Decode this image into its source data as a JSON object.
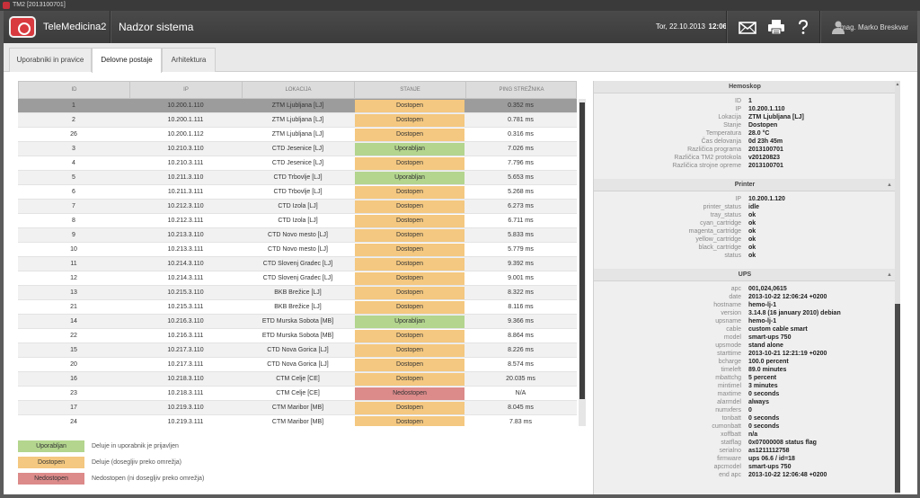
{
  "window": {
    "title": "TM2  [2013100701]"
  },
  "header": {
    "brand": "TeleMedicina2",
    "title": "Nadzor sistema",
    "date": "Tor, 22.10.2013",
    "time": "12:06",
    "user": "mag. Marko Breskvar",
    "icons": [
      "envelope-icon",
      "printer-icon",
      "help-icon",
      "user-icon"
    ]
  },
  "tabs": [
    {
      "label": "Uporabniki in pravice",
      "active": false
    },
    {
      "label": "Delovne postaje",
      "active": true
    },
    {
      "label": "Arhitektura",
      "active": false
    }
  ],
  "table": {
    "headers": [
      "ID",
      "IP",
      "LOKACIJA",
      "STANJE",
      "PING STREŽNIKA"
    ],
    "rows": [
      {
        "id": "1",
        "ip": "10.200.1.110",
        "loc": "ZTM Ljubljana [LJ]",
        "state": "Dostopen",
        "ping": "0.352 ms",
        "selected": true
      },
      {
        "id": "2",
        "ip": "10.200.1.111",
        "loc": "ZTM Ljubljana [LJ]",
        "state": "Dostopen",
        "ping": "0.781 ms"
      },
      {
        "id": "26",
        "ip": "10.200.1.112",
        "loc": "ZTM Ljubljana [LJ]",
        "state": "Dostopen",
        "ping": "0.316 ms"
      },
      {
        "id": "3",
        "ip": "10.210.3.110",
        "loc": "CTD Jesenice [LJ]",
        "state": "Uporabljan",
        "ping": "7.026 ms"
      },
      {
        "id": "4",
        "ip": "10.210.3.111",
        "loc": "CTD Jesenice [LJ]",
        "state": "Dostopen",
        "ping": "7.796 ms"
      },
      {
        "id": "5",
        "ip": "10.211.3.110",
        "loc": "CTD Trbovlje [LJ]",
        "state": "Uporabljan",
        "ping": "5.653 ms"
      },
      {
        "id": "6",
        "ip": "10.211.3.111",
        "loc": "CTD Trbovlje [LJ]",
        "state": "Dostopen",
        "ping": "5.268 ms"
      },
      {
        "id": "7",
        "ip": "10.212.3.110",
        "loc": "CTD Izola [LJ]",
        "state": "Dostopen",
        "ping": "6.273 ms"
      },
      {
        "id": "8",
        "ip": "10.212.3.111",
        "loc": "CTD Izola [LJ]",
        "state": "Dostopen",
        "ping": "6.711 ms"
      },
      {
        "id": "9",
        "ip": "10.213.3.110",
        "loc": "CTD Novo mesto [LJ]",
        "state": "Dostopen",
        "ping": "5.833 ms"
      },
      {
        "id": "10",
        "ip": "10.213.3.111",
        "loc": "CTD Novo mesto [LJ]",
        "state": "Dostopen",
        "ping": "5.779 ms"
      },
      {
        "id": "11",
        "ip": "10.214.3.110",
        "loc": "CTD Slovenj Gradec [LJ]",
        "state": "Dostopen",
        "ping": "9.392 ms"
      },
      {
        "id": "12",
        "ip": "10.214.3.111",
        "loc": "CTD Slovenj Gradec [LJ]",
        "state": "Dostopen",
        "ping": "9.001 ms"
      },
      {
        "id": "13",
        "ip": "10.215.3.110",
        "loc": "BKB Brežice [LJ]",
        "state": "Dostopen",
        "ping": "8.322 ms"
      },
      {
        "id": "21",
        "ip": "10.215.3.111",
        "loc": "BKB Brežice [LJ]",
        "state": "Dostopen",
        "ping": "8.116 ms"
      },
      {
        "id": "14",
        "ip": "10.216.3.110",
        "loc": "ETD Murska Sobota [MB]",
        "state": "Uporabljan",
        "ping": "9.366 ms"
      },
      {
        "id": "22",
        "ip": "10.216.3.111",
        "loc": "ETD Murska Sobota [MB]",
        "state": "Dostopen",
        "ping": "8.864 ms"
      },
      {
        "id": "15",
        "ip": "10.217.3.110",
        "loc": "CTD Nova Gorica [LJ]",
        "state": "Dostopen",
        "ping": "8.226 ms"
      },
      {
        "id": "20",
        "ip": "10.217.3.111",
        "loc": "CTD Nova Gorica [LJ]",
        "state": "Dostopen",
        "ping": "8.574 ms"
      },
      {
        "id": "16",
        "ip": "10.218.3.110",
        "loc": "CTM Celje [CE]",
        "state": "Dostopen",
        "ping": "20.035 ms"
      },
      {
        "id": "23",
        "ip": "10.218.3.111",
        "loc": "CTM Celje [CE]",
        "state": "Nedostopen",
        "ping": "N/A"
      },
      {
        "id": "17",
        "ip": "10.219.3.110",
        "loc": "CTM Maribor [MB]",
        "state": "Dostopen",
        "ping": "8.045 ms"
      },
      {
        "id": "24",
        "ip": "10.219.3.111",
        "loc": "CTM Maribor [MB]",
        "state": "Dostopen",
        "ping": "7.83 ms"
      }
    ]
  },
  "state_colors": {
    "Uporabljan": "#b3d58e",
    "Dostopen": "#f4c880",
    "Nedostopen": "#dc8a8a"
  },
  "legend": [
    {
      "label": "Uporabljan",
      "text": "Deluje in uporabnik je prijavljen"
    },
    {
      "label": "Dostopen",
      "text": "Deluje (dosegljiv preko omrežja)"
    },
    {
      "label": "Nedostopen",
      "text": "Nedostopen (ni dosegljiv preko omrežja)"
    }
  ],
  "panel": {
    "hemoskop": {
      "title": "Hemoskop",
      "items": [
        [
          "ID",
          "1"
        ],
        [
          "IP",
          "10.200.1.110"
        ],
        [
          "Lokacija",
          "ZTM Ljubljana [LJ]"
        ],
        [
          "Stanje",
          "Dostopen"
        ],
        [
          "Temperatura",
          "28.0 °C"
        ],
        [
          "Čas delovanja",
          "0d 23h 45m"
        ],
        [
          "Različica programa",
          "2013100701"
        ],
        [
          "Različica TM2 protokola",
          "v20120823"
        ],
        [
          "Različica strojne opreme",
          "2013100701"
        ]
      ]
    },
    "printer": {
      "title": "Printer",
      "items": [
        [
          "IP",
          "10.200.1.120"
        ],
        [
          "printer_status",
          "idle"
        ],
        [
          "tray_status",
          "ok"
        ],
        [
          "cyan_cartridge",
          "ok"
        ],
        [
          "magenta_cartridge",
          "ok"
        ],
        [
          "yellow_cartridge",
          "ok"
        ],
        [
          "black_cartridge",
          "ok"
        ],
        [
          "status",
          "ok"
        ]
      ]
    },
    "ups": {
      "title": "UPS",
      "items": [
        [
          "apc",
          "001,024,0615"
        ],
        [
          "date",
          "2013-10-22 12:06:24 +0200"
        ],
        [
          "hostname",
          "hemo-lj-1"
        ],
        [
          "version",
          "3.14.8 (16 january 2010) debian"
        ],
        [
          "upsname",
          "hemo-lj-1"
        ],
        [
          "cable",
          "custom cable smart"
        ],
        [
          "model",
          "smart-ups 750"
        ],
        [
          "upsmode",
          "stand alone"
        ],
        [
          "starttime",
          "2013-10-21 12:21:19 +0200"
        ],
        [
          "bcharge",
          "100.0 percent"
        ],
        [
          "timeleft",
          "89.0 minutes"
        ],
        [
          "mbattchg",
          "5 percent"
        ],
        [
          "mintimel",
          "3 minutes"
        ],
        [
          "maxtime",
          "0 seconds"
        ],
        [
          "alarmdel",
          "always"
        ],
        [
          "numxfers",
          "0"
        ],
        [
          "tonbatt",
          "0 seconds"
        ],
        [
          "cumonbatt",
          "0 seconds"
        ],
        [
          "xoffbatt",
          "n/a"
        ],
        [
          "statflag",
          "0x07000008 status flag"
        ],
        [
          "serialno",
          "as1211112758"
        ],
        [
          "firmware",
          "ups 06.6 / id=18"
        ],
        [
          "apcmodel",
          "smart-ups 750"
        ],
        [
          "end apc",
          "2013-10-22 12:06:48 +0200"
        ]
      ]
    }
  }
}
